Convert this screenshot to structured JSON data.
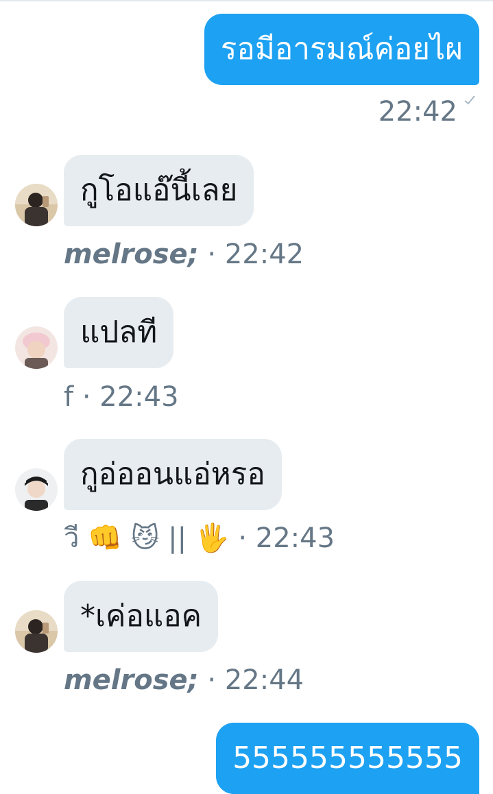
{
  "messages": [
    {
      "text": "รอมีอารมณ์ค่อยไผ",
      "time": "22:42"
    },
    {
      "text": "กูโอแอ๊นี้เลย",
      "sender": "melrose;",
      "time": "· 22:42"
    },
    {
      "text": "แปลที",
      "sender": "f",
      "time": "· 22:43"
    },
    {
      "text": "กูอ่ออนแอ่หรอ",
      "sender": "วี",
      "emojis": [
        "👊",
        "😼",
        "||",
        "🖐"
      ],
      "time": "· 22:43"
    },
    {
      "text": "*เค่อแอค",
      "sender": "melrose;",
      "time": "· 22:44"
    },
    {
      "text": "555555555555"
    }
  ],
  "icons": {
    "read_check": "check-icon"
  },
  "colors": {
    "outgoing_bubble": "#1da1f2",
    "incoming_bubble": "#e6ecf0",
    "meta_text": "#657786"
  }
}
